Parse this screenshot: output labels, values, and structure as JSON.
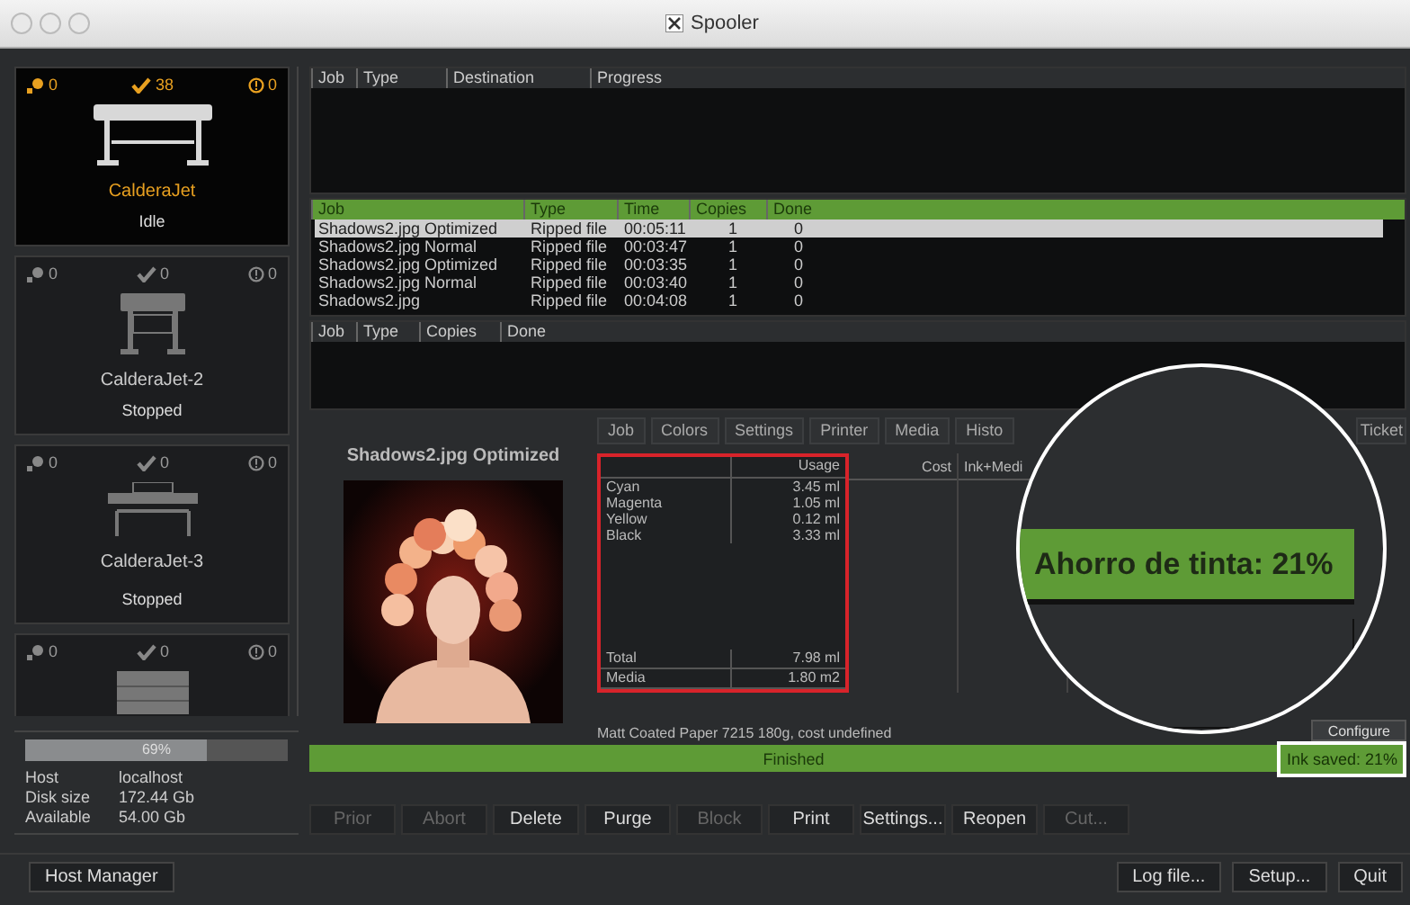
{
  "window": {
    "title": "Spooler"
  },
  "printers": [
    {
      "kind": "wide",
      "pending": "0",
      "done": "38",
      "errors": "0",
      "name": "CalderaJet",
      "status": "Idle",
      "selected": true
    },
    {
      "kind": "stand",
      "pending": "0",
      "done": "0",
      "errors": "0",
      "name": "CalderaJet-2",
      "status": "Stopped",
      "selected": false
    },
    {
      "kind": "flatbed",
      "pending": "0",
      "done": "0",
      "errors": "0",
      "name": "CalderaJet-3",
      "status": "Stopped",
      "selected": false
    },
    {
      "kind": "box",
      "pending": "0",
      "done": "0",
      "errors": "0",
      "selected": false
    }
  ],
  "disk": {
    "level": 0.69,
    "reading": "69%",
    "rows": [
      {
        "label": "Host",
        "value": "localhost"
      },
      {
        "label": "Disk size",
        "value": "172.44 Gb"
      },
      {
        "label": "Available",
        "value": "54.00 Gb"
      }
    ]
  },
  "host_manager_button": "Host Manager",
  "active_jobs": {
    "columns": [
      "Job",
      "Type",
      "Destination",
      "Progress"
    ]
  },
  "ripped_jobs": {
    "columns": [
      "Job",
      "Type",
      "Time",
      "Copies",
      "Done"
    ],
    "rows": [
      {
        "cells": [
          "Shadows2.jpg Optimized",
          "Ripped file",
          "00:05:11",
          "1",
          "0"
        ],
        "selected": true
      },
      {
        "cells": [
          "Shadows2.jpg Normal",
          "Ripped file",
          "00:03:47",
          "1",
          "0"
        ],
        "selected": false
      },
      {
        "cells": [
          "Shadows2.jpg Optimized",
          "Ripped file",
          "00:03:35",
          "1",
          "0"
        ],
        "selected": false
      },
      {
        "cells": [
          "Shadows2.jpg Normal",
          "Ripped file",
          "00:03:40",
          "1",
          "0"
        ],
        "selected": false
      },
      {
        "cells": [
          "Shadows2.jpg",
          "Ripped file",
          "00:04:08",
          "1",
          "0"
        ],
        "selected": false
      }
    ]
  },
  "printed_jobs": {
    "columns": [
      "Job",
      "Type",
      "Copies",
      "Done"
    ]
  },
  "preview": {
    "title": "Shadows2.jpg Optimized"
  },
  "detail_tabs": [
    "Job",
    "Colors",
    "Settings",
    "Printer",
    "Media",
    "Histo",
    "Ticket"
  ],
  "usage": {
    "columns": [
      "Usage",
      "Cost",
      "Ink+Medi"
    ],
    "inks": [
      {
        "name": "Cyan",
        "usage": "3.45 ml"
      },
      {
        "name": "Magenta",
        "usage": "1.05 ml"
      },
      {
        "name": "Yellow",
        "usage": "0.12 ml"
      },
      {
        "name": "Black",
        "usage": "3.33 ml"
      }
    ],
    "totals": [
      {
        "name": "Total",
        "usage": "7.98 ml"
      },
      {
        "name": "Media",
        "usage": "1.80 m2"
      }
    ]
  },
  "media_note": "Matt Coated Paper 7215 180g, cost undefined",
  "configure_button": "Configure",
  "status_bar": {
    "text": "Finished",
    "ink_saved": "Ink saved: 21%"
  },
  "action_buttons": [
    {
      "label": "Prior",
      "disabled": true
    },
    {
      "label": "Abort",
      "disabled": true
    },
    {
      "label": "Delete",
      "disabled": false
    },
    {
      "label": "Purge",
      "disabled": false
    },
    {
      "label": "Block",
      "disabled": true
    },
    {
      "label": "Print",
      "disabled": false
    },
    {
      "label": "Settings...",
      "disabled": false
    },
    {
      "label": "Reopen",
      "disabled": false
    },
    {
      "label": "Cut...",
      "disabled": true
    }
  ],
  "footer_buttons": [
    "Log file...",
    "Setup...",
    "Quit"
  ],
  "callout": {
    "text": "Ahorro de tinta: 21%"
  }
}
